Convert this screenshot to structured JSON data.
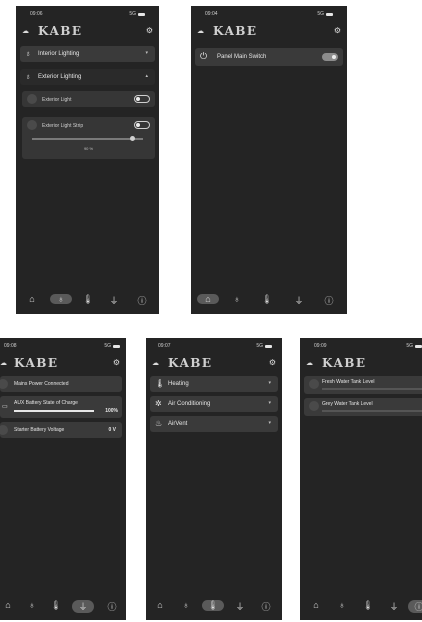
{
  "brand": "KABE",
  "battery_level": 1.0,
  "screens": [
    {
      "time": "09:06",
      "signal": "5G",
      "groups": [
        {
          "label": "Interior Lighting",
          "chevron": "⌄"
        },
        {
          "label": "Exterior Lighting",
          "chevron": "⌃"
        }
      ],
      "items": [
        {
          "label": "Exterior Light",
          "on": false
        },
        {
          "label": "Exterior Light Strip",
          "on": false
        }
      ],
      "slider_value": 90,
      "slider_text": "90 %",
      "active_tab": "lighting"
    },
    {
      "time": "09:04",
      "signal": "5G",
      "items": [
        {
          "label": "Panel Main Switch",
          "on": true
        }
      ],
      "active_tab": "home"
    },
    {
      "time": "09:08",
      "signal": "5G",
      "items": [
        {
          "label": "Mains Power Connected"
        },
        {
          "label": "AUX Battery State of Charge",
          "value_text": "100%",
          "level": 1.0
        },
        {
          "label": "Starter Battery Voltage",
          "value_text": "0 V"
        }
      ],
      "active_tab": "power"
    },
    {
      "time": "09:07",
      "signal": "5G",
      "groups": [
        {
          "label": "Heating"
        },
        {
          "label": "Air Conditioning"
        },
        {
          "label": "AirVent"
        }
      ],
      "active_tab": "climate"
    },
    {
      "time": "09:09",
      "signal": "5G",
      "items": [
        {
          "label": "Fresh Water Tank Level"
        },
        {
          "label": "Grey Water Tank Level"
        }
      ],
      "active_tab": "tanks"
    }
  ],
  "icons": {
    "cloud": "cloud-icon",
    "gear": "gear-icon",
    "home": "home-icon",
    "bulb": "lightbulb-icon",
    "thermo": "thermometer-icon",
    "plug": "plug-icon",
    "info": "info-icon"
  }
}
